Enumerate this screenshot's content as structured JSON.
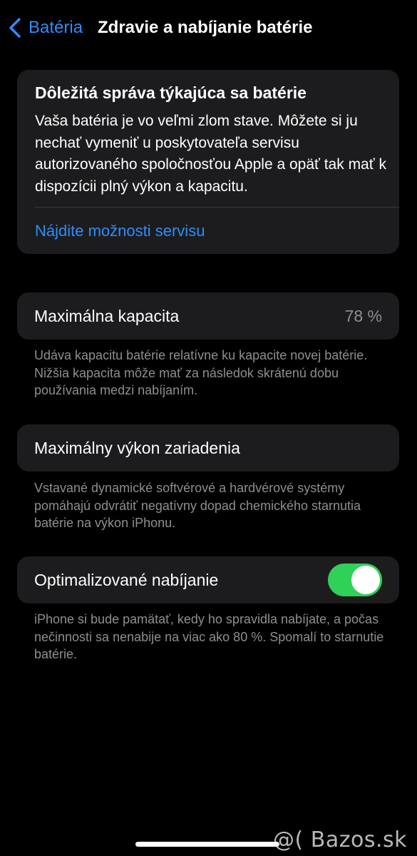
{
  "nav": {
    "back_label": "Batéria",
    "title": "Zdravie a nabíjanie batérie"
  },
  "message": {
    "title": "Dôležitá správa týkajúca sa batérie",
    "body": "Vaša batéria je vo veľmi zlom stave. Môžete si ju nechať vymeniť u poskytovateľa servisu autorizovaného spoločnosťou Apple a opäť tak mať k dispozícii plný výkon a kapacitu.",
    "link": "Nájdite možnosti servisu"
  },
  "max_capacity": {
    "label": "Maximálna kapacita",
    "value": "78 %",
    "footnote": "Udáva kapacitu batérie relatívne ku kapacite novej batérie. Nižšia kapacita môže mať za následok skrátenú dobu používania medzi nabíjaním."
  },
  "peak_performance": {
    "label": "Maximálny výkon zariadenia",
    "footnote": "Vstavané dynamické softvérové a hardvérové systémy pomáhajú odvrátiť negatívny dopad chemického starnutia batérie na výkon iPhonu."
  },
  "optimized_charging": {
    "label": "Optimalizované nabíjanie",
    "enabled": true,
    "footnote": "iPhone si bude pamätať, kedy ho spravidla nabíjate, a počas nečinnosti sa nenabije na viac ako 80 %. Spomalí to starnutie batérie."
  },
  "watermark": "@( Bazos.sk",
  "colors": {
    "accent": "#2f8dfa",
    "toggle_on": "#30d158",
    "card_bg": "#1c1c1e",
    "secondary_text": "#8e8e93"
  },
  "icons": {
    "back": "chevron-left-icon"
  }
}
